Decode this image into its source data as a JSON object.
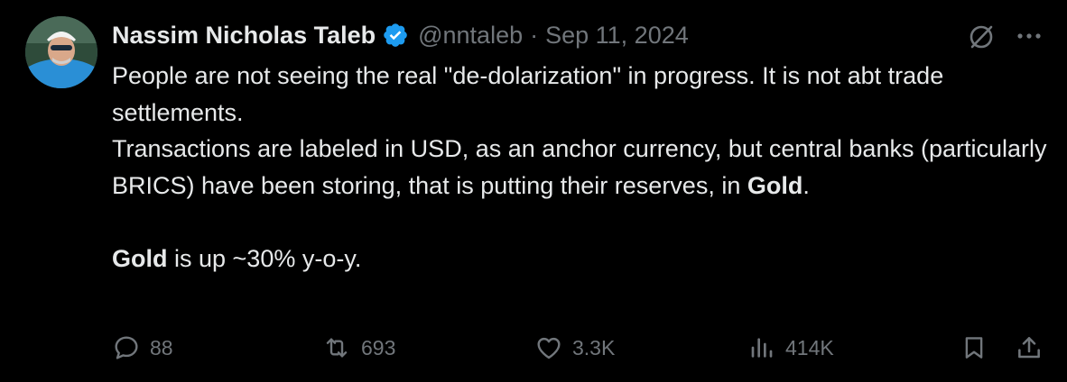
{
  "author": {
    "name": "Nassim Nicholas Taleb",
    "handle": "@nntaleb",
    "separator": "·",
    "date": "Sep 11, 2024",
    "verified": true,
    "verified_color": "#1d9bf0"
  },
  "body": {
    "line1": "People are not seeing the real \"de-dolarization\" in progress. It is not abt trade settlements.",
    "line2_before": "Transactions are labeled in USD, as an anchor currency, but central banks (particularly BRICS) have been storing, that is putting their reserves, in ",
    "line2_bold": "Gold",
    "line2_after": ".",
    "line3_bold": "Gold",
    "line3_after": " is up ~30% y-o-y."
  },
  "actions": {
    "replies": "88",
    "reposts": "693",
    "likes": "3.3K",
    "views": "414K"
  },
  "icons": {
    "grok": "grok-icon",
    "more": "more-icon",
    "reply": "reply-icon",
    "repost": "repost-icon",
    "like": "heart-icon",
    "views": "views-icon",
    "bookmark": "bookmark-icon",
    "share": "share-icon"
  },
  "colors": {
    "background": "#000000",
    "text": "#e7e9ea",
    "muted": "#71767b"
  }
}
